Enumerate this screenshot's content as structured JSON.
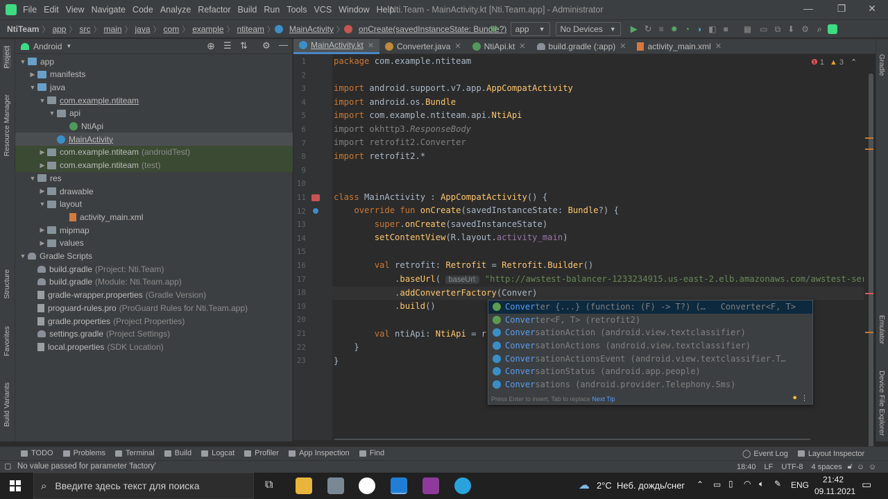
{
  "window": {
    "menu": [
      "File",
      "Edit",
      "View",
      "Navigate",
      "Code",
      "Analyze",
      "Refactor",
      "Build",
      "Run",
      "Tools",
      "VCS",
      "Window",
      "Help"
    ],
    "title": "Nti.Team - MainActivity.kt [Nti.Team.app] - Administrator"
  },
  "breadcrumb": [
    "NtiTeam",
    "app",
    "src",
    "main",
    "java",
    "com",
    "example",
    "ntiteam",
    "MainActivity",
    "onCreate(savedInstanceState: Bundle?)"
  ],
  "toolbar": {
    "module": "app",
    "device": "No Devices"
  },
  "left_stripe": [
    "Project",
    "Resource Manager",
    "Structure",
    "Favorites",
    "Build Variants"
  ],
  "right_stripe": [
    "Gradle",
    "Emulator",
    "Device File Explorer"
  ],
  "project": {
    "view": "Android",
    "tree": [
      {
        "label": "app",
        "muted": "",
        "arrow": "▼",
        "icon": "folder-blue"
      },
      {
        "label": "manifests",
        "muted": "",
        "arrow": "▶",
        "icon": "folder-blue"
      },
      {
        "label": "java",
        "muted": "",
        "arrow": "▼",
        "icon": "folder-blue"
      },
      {
        "label": "com.example.ntiteam",
        "muted": "",
        "arrow": "▼",
        "icon": "folder"
      },
      {
        "label": "api",
        "muted": "",
        "arrow": "▼",
        "icon": "folder"
      },
      {
        "label": "NtiApi",
        "muted": "",
        "arrow": "",
        "icon": "kotlin"
      },
      {
        "label": "MainActivity",
        "muted": "",
        "arrow": "",
        "icon": "kotlin-class"
      },
      {
        "label": "com.example.ntiteam",
        "muted": "(androidTest)",
        "arrow": "▶",
        "icon": "folder"
      },
      {
        "label": "com.example.ntiteam",
        "muted": "(test)",
        "arrow": "▶",
        "icon": "folder"
      },
      {
        "label": "res",
        "muted": "",
        "arrow": "▼",
        "icon": "folder"
      },
      {
        "label": "drawable",
        "muted": "",
        "arrow": "▶",
        "icon": "folder"
      },
      {
        "label": "layout",
        "muted": "",
        "arrow": "▼",
        "icon": "folder"
      },
      {
        "label": "activity_main.xml",
        "muted": "",
        "arrow": "",
        "icon": "xml"
      },
      {
        "label": "mipmap",
        "muted": "",
        "arrow": "▶",
        "icon": "folder"
      },
      {
        "label": "values",
        "muted": "",
        "arrow": "▶",
        "icon": "folder"
      },
      {
        "label": "Gradle Scripts",
        "muted": "",
        "arrow": "▼",
        "icon": "gradle"
      },
      {
        "label": "build.gradle",
        "muted": "(Project: Nti.Team)",
        "arrow": "",
        "icon": "gradle"
      },
      {
        "label": "build.gradle",
        "muted": "(Module: Nti.Team.app)",
        "arrow": "",
        "icon": "gradle"
      },
      {
        "label": "gradle-wrapper.properties",
        "muted": "(Gradle Version)",
        "arrow": "",
        "icon": "doc"
      },
      {
        "label": "proguard-rules.pro",
        "muted": "(ProGuard Rules for Nti.Team.app)",
        "arrow": "",
        "icon": "doc"
      },
      {
        "label": "gradle.properties",
        "muted": "(Project Properties)",
        "arrow": "",
        "icon": "doc"
      },
      {
        "label": "settings.gradle",
        "muted": "(Project Settings)",
        "arrow": "",
        "icon": "gradle"
      },
      {
        "label": "local.properties",
        "muted": "(SDK Location)",
        "arrow": "",
        "icon": "doc"
      }
    ]
  },
  "tabs": [
    "MainActivity.kt",
    "Converter.java",
    "NtiApi.kt",
    "build.gradle (:app)",
    "activity_main.xml"
  ],
  "inspections": {
    "errors": "1",
    "warnings": "3"
  },
  "editor": {
    "line_numbers": [
      "1",
      "2",
      "3",
      "4",
      "5",
      "6",
      "7",
      "8",
      "9",
      "10",
      "11",
      "12",
      "13",
      "14",
      "15",
      "16",
      "17",
      "18",
      "19",
      "20",
      "21",
      "22",
      "23"
    ],
    "baseurl_hint": "baseUrl:"
  },
  "completion": {
    "items": [
      {
        "match": "Conver",
        "rest": "ter {...} (function: (F) -> T?) (…   Converter<F, T>",
        "kind": "f"
      },
      {
        "match": "Conver",
        "rest": "ter<F, T> (retrofit2)",
        "kind": "f"
      },
      {
        "match": "Conver",
        "rest": "sationAction (android.view.textclassifier)",
        "kind": "c"
      },
      {
        "match": "Conver",
        "rest": "sationActions (android.view.textclassifier)",
        "kind": "c"
      },
      {
        "match": "Conver",
        "rest": "sationActionsEvent (android.view.textclassifier.T…",
        "kind": "c"
      },
      {
        "match": "Conver",
        "rest": "sationStatus (android.app.people)",
        "kind": "c"
      },
      {
        "match": "Conver",
        "rest": "sations (android.provider.Telephony.Sms)",
        "kind": "c"
      }
    ],
    "footer": "Press Enter to insert, Tab to replace",
    "next_tip": "Next Tip"
  },
  "tool_windows": [
    "TODO",
    "Problems",
    "Terminal",
    "Build",
    "Logcat",
    "Profiler",
    "App Inspection",
    "Find"
  ],
  "tool_windows_right": [
    "Event Log",
    "Layout Inspector"
  ],
  "status": {
    "message": "No value passed for parameter 'factory'",
    "position": "18:40",
    "line_sep": "LF",
    "encoding": "UTF-8",
    "indent": "4 spaces"
  },
  "taskbar": {
    "search_placeholder": "Введите здесь текст для поиска",
    "weather": "2°C  Неб. дождь/снег",
    "lang": "ENG",
    "time": "21:42",
    "date": "09.11.2021"
  },
  "colors": {
    "accent": "#4a88c7",
    "keyword": "#cc7832",
    "function": "#ffc66d",
    "string": "#6a8759"
  }
}
